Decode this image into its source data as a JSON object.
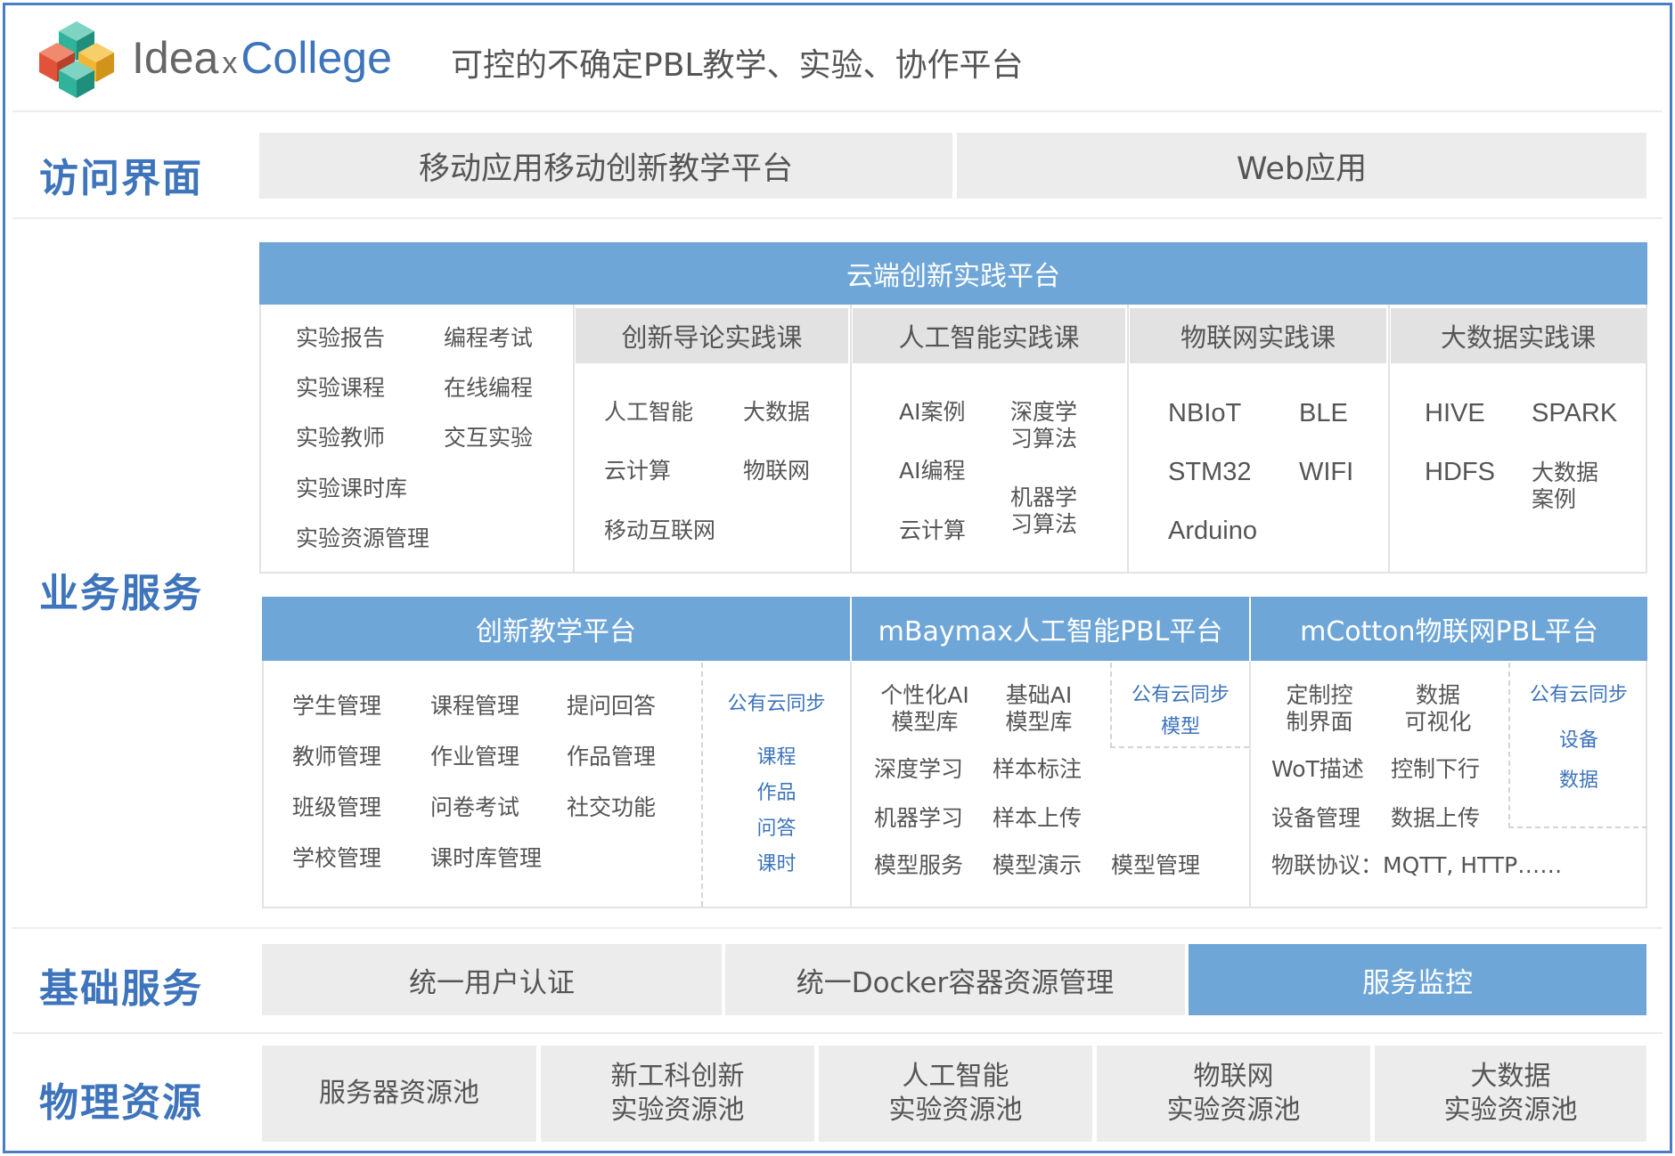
{
  "header": {
    "logo_idea": "Idea",
    "logo_x": "x",
    "logo_college": "College",
    "tagline": "可控的不确定PBL教学、实验、协作平台"
  },
  "sections": {
    "access": "访问界面",
    "business": "业务服务",
    "basic": "基础服务",
    "physical": "物理资源"
  },
  "access": {
    "mobile": "移动应用移动创新教学平台",
    "web": "Web应用"
  },
  "cloud": {
    "title": "云端创新实践平台",
    "left_items": [
      "实验报告",
      "编程考试",
      "实验课程",
      "在线编程",
      "实验教师",
      "交互实验",
      "实验课时库",
      "实验资源管理"
    ],
    "course_intro": {
      "title": "创新导论实践课",
      "items": [
        "人工智能",
        "大数据",
        "云计算",
        "物联网",
        "移动互联网"
      ]
    },
    "course_ai": {
      "title": "人工智能实践课",
      "items": [
        "AI案例",
        "深度学\n习算法",
        "AI编程",
        "机器学\n习算法",
        "云计算"
      ]
    },
    "course_iot": {
      "title": "物联网实践课",
      "items": [
        "NBIoT",
        "BLE",
        "STM32",
        "WIFI",
        "Arduino"
      ]
    },
    "course_bigdata": {
      "title": "大数据实践课",
      "items": [
        "HIVE",
        "SPARK",
        "HDFS",
        "大数据\n案例"
      ]
    }
  },
  "teach": {
    "title": "创新教学平台",
    "items": [
      "学生管理",
      "课程管理",
      "提问回答",
      "教师管理",
      "作业管理",
      "作品管理",
      "班级管理",
      "问卷考试",
      "社交功能",
      "学校管理",
      "课时库管理"
    ],
    "sync_title": "公有云同步",
    "sync_items": [
      "课程",
      "作品",
      "问答",
      "课时"
    ]
  },
  "mbaymax": {
    "title": "mBaymax人工智能PBL平台",
    "items": [
      "个性化AI\n模型库",
      "基础AI\n模型库",
      "深度学习",
      "样本标注",
      "机器学习",
      "样本上传",
      "模型服务",
      "模型演示",
      "模型管理"
    ],
    "sync_title": "公有云同步",
    "sync_items": [
      "模型"
    ]
  },
  "mcotton": {
    "title": "mCotton物联网PBL平台",
    "items": [
      "定制控\n制界面",
      "数据\n可视化",
      "WoT描述",
      "控制下行",
      "设备管理",
      "数据上传"
    ],
    "protocol": "物联协议：MQTT, HTTP……",
    "sync_title": "公有云同步",
    "sync_items": [
      "设备",
      "数据"
    ]
  },
  "basic": {
    "auth": "统一用户认证",
    "docker": "统一Docker容器资源管理",
    "monitor": "服务监控"
  },
  "physical": {
    "items": [
      "服务器资源池",
      "新工科创新\n实验资源池",
      "人工智能\n实验资源池",
      "物联网\n实验资源池",
      "大数据\n实验资源池"
    ]
  },
  "colors": {
    "brand_blue": "#3d74bb",
    "panel_blue": "#6fa6d8",
    "panel_grey": "#ececec",
    "logo_red": "#e0533a",
    "logo_green": "#2fb39a",
    "logo_yellow": "#f2b632"
  }
}
